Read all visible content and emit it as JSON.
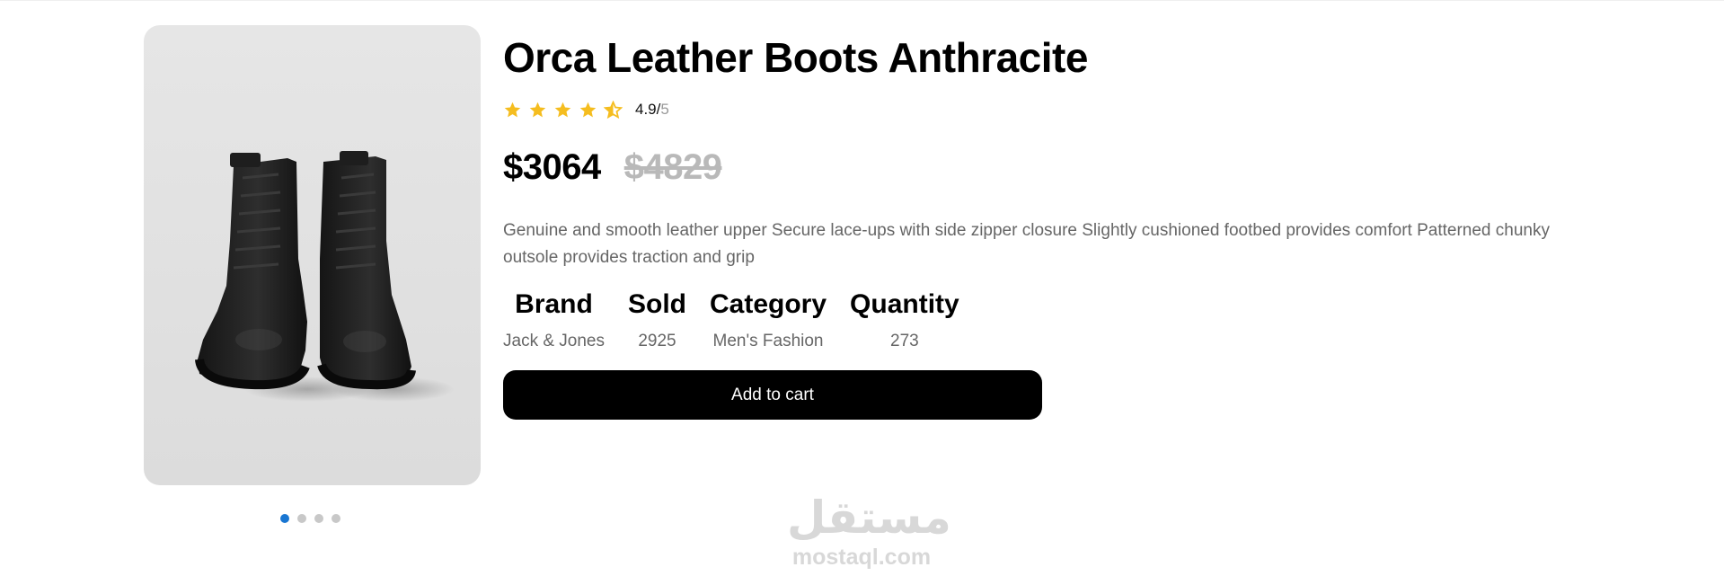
{
  "product": {
    "title": "Orca Leather Boots Anthracite",
    "rating": "4.9/",
    "rating_max": "5",
    "stars": [
      {
        "icon": "star-full-icon"
      },
      {
        "icon": "star-full-icon"
      },
      {
        "icon": "star-full-icon"
      },
      {
        "icon": "star-full-icon"
      },
      {
        "icon": "star-half-icon"
      }
    ],
    "price": "$3064",
    "old_price": "$4829",
    "description": "Genuine and smooth leather upper Secure lace-ups with side zipper closure Slightly cushioned footbed provides comfort Patterned chunky outsole provides traction and grip",
    "specs": [
      {
        "label": "Brand",
        "value": "Jack & Jones"
      },
      {
        "label": "Sold",
        "value": "2925"
      },
      {
        "label": "Category",
        "value": "Men's Fashion"
      },
      {
        "label": "Quantity",
        "value": "273"
      }
    ],
    "add_to_cart_label": "Add to cart"
  },
  "carousel": {
    "slide_count": 4,
    "active_index": 0
  },
  "watermark": {
    "arabic": "مستقل",
    "latin": "mostaql.com"
  },
  "colors": {
    "star": "#f5bd1f",
    "dot_active": "#1976d2",
    "dot_inactive": "#c8c8c8",
    "button_bg": "#000000",
    "button_text": "#ffffff"
  }
}
